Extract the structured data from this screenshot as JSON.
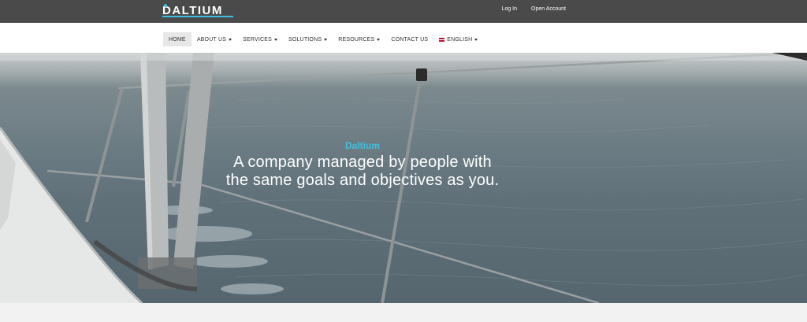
{
  "brand": {
    "logo_text": "DALTIUM"
  },
  "topbar": {
    "login": "Log In",
    "open_account": "Open Account"
  },
  "nav": {
    "items": [
      {
        "label": "HOME",
        "dropdown": false,
        "active": true
      },
      {
        "label": "ABOUT US",
        "dropdown": true
      },
      {
        "label": "SERVICES",
        "dropdown": true
      },
      {
        "label": "SOLUTIONS",
        "dropdown": true
      },
      {
        "label": "RESOURCES",
        "dropdown": true
      },
      {
        "label": "CONTACT US",
        "dropdown": false
      },
      {
        "label": "ENGLISH",
        "dropdown": true,
        "flag": "uk-flag-icon"
      }
    ]
  },
  "hero": {
    "brand": "Daltium",
    "tagline_line1": "A company managed by people with",
    "tagline_line2": "the same goals and objectives as you."
  },
  "colors": {
    "accent": "#3fc0e0",
    "topbar": "#4a4a4a"
  }
}
